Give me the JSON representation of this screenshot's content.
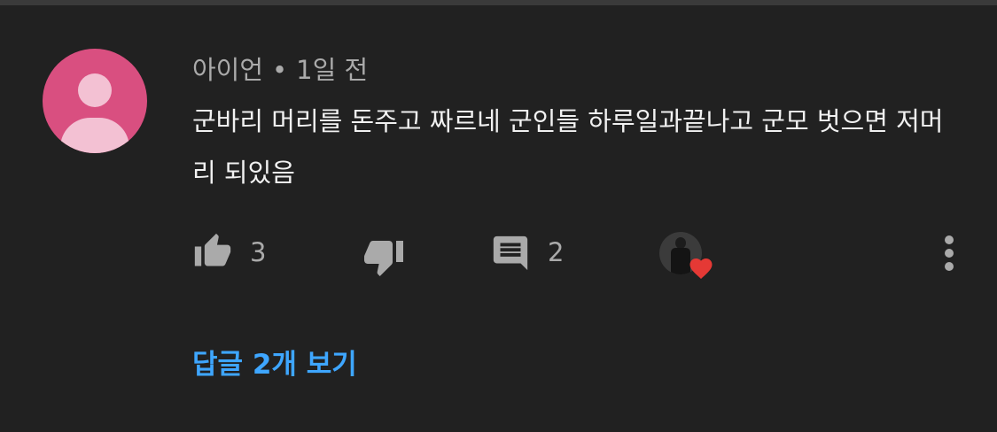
{
  "comment": {
    "author": "아이언",
    "separator": "•",
    "timestamp": "1일 전",
    "text": "군바리 머리를 돈주고 짜르네  군인들 하루일과끝나고 군모 벗으면 저머리 되있음"
  },
  "actions": {
    "like_count": "3",
    "reply_count": "2",
    "heart_color": "#e53935"
  },
  "replies": {
    "link_label": "답글 2개 보기"
  },
  "colors": {
    "background": "#212121",
    "author_avatar": "#d94f80",
    "link": "#3ea6ff"
  }
}
